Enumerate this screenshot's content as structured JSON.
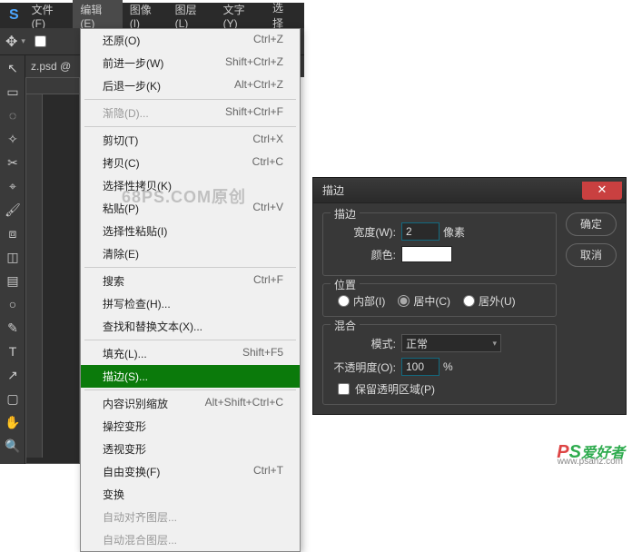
{
  "menubar": {
    "logo": "S",
    "items": [
      "文件(F)",
      "编辑(E)",
      "图像(I)",
      "图层(L)",
      "文字(Y)",
      "选择"
    ]
  },
  "tab": {
    "label": "z.psd @"
  },
  "watermark": "68PS.COM原创",
  "corner": {
    "p": "P",
    "s": "S",
    "cn": "爱好者",
    "url": "www.psahz.com"
  },
  "dropdown": {
    "groups": [
      [
        {
          "label": "还原(O)",
          "shortcut": "Ctrl+Z"
        },
        {
          "label": "前进一步(W)",
          "shortcut": "Shift+Ctrl+Z"
        },
        {
          "label": "后退一步(K)",
          "shortcut": "Alt+Ctrl+Z"
        }
      ],
      [
        {
          "label": "渐隐(D)...",
          "shortcut": "Shift+Ctrl+F",
          "disabled": true
        }
      ],
      [
        {
          "label": "剪切(T)",
          "shortcut": "Ctrl+X"
        },
        {
          "label": "拷贝(C)",
          "shortcut": "Ctrl+C"
        },
        {
          "label": "选择性拷贝(K)",
          "shortcut": ""
        },
        {
          "label": "粘贴(P)",
          "shortcut": "Ctrl+V"
        },
        {
          "label": "选择性粘贴(I)",
          "shortcut": ""
        },
        {
          "label": "清除(E)",
          "shortcut": ""
        }
      ],
      [
        {
          "label": "搜索",
          "shortcut": "Ctrl+F"
        },
        {
          "label": "拼写检查(H)...",
          "shortcut": ""
        },
        {
          "label": "查找和替换文本(X)...",
          "shortcut": ""
        }
      ],
      [
        {
          "label": "填充(L)...",
          "shortcut": "Shift+F5"
        },
        {
          "label": "描边(S)...",
          "shortcut": "",
          "highlight": true
        }
      ],
      [
        {
          "label": "内容识别缩放",
          "shortcut": "Alt+Shift+Ctrl+C"
        },
        {
          "label": "操控变形",
          "shortcut": ""
        },
        {
          "label": "透视变形",
          "shortcut": ""
        },
        {
          "label": "自由变换(F)",
          "shortcut": "Ctrl+T"
        },
        {
          "label": "变换",
          "shortcut": ""
        },
        {
          "label": "自动对齐图层...",
          "shortcut": "",
          "disabled": true
        },
        {
          "label": "自动混合图层...",
          "shortcut": "",
          "disabled": true
        }
      ]
    ]
  },
  "dialog": {
    "title": "描边",
    "buttons": {
      "ok": "确定",
      "cancel": "取消"
    },
    "stroke": {
      "legend": "描边",
      "width_label": "宽度(W):",
      "width_value": "2",
      "width_unit": "像素",
      "color_label": "颜色:",
      "color_value": "#ffffff"
    },
    "position": {
      "legend": "位置",
      "options": [
        {
          "label": "内部(I)",
          "checked": false
        },
        {
          "label": "居中(C)",
          "checked": true
        },
        {
          "label": "居外(U)",
          "checked": false
        }
      ]
    },
    "blend": {
      "legend": "混合",
      "mode_label": "模式:",
      "mode_value": "正常",
      "opacity_label": "不透明度(O):",
      "opacity_value": "100",
      "opacity_unit": "%",
      "preserve_label": "保留透明区域(P)",
      "preserve_checked": false
    }
  }
}
